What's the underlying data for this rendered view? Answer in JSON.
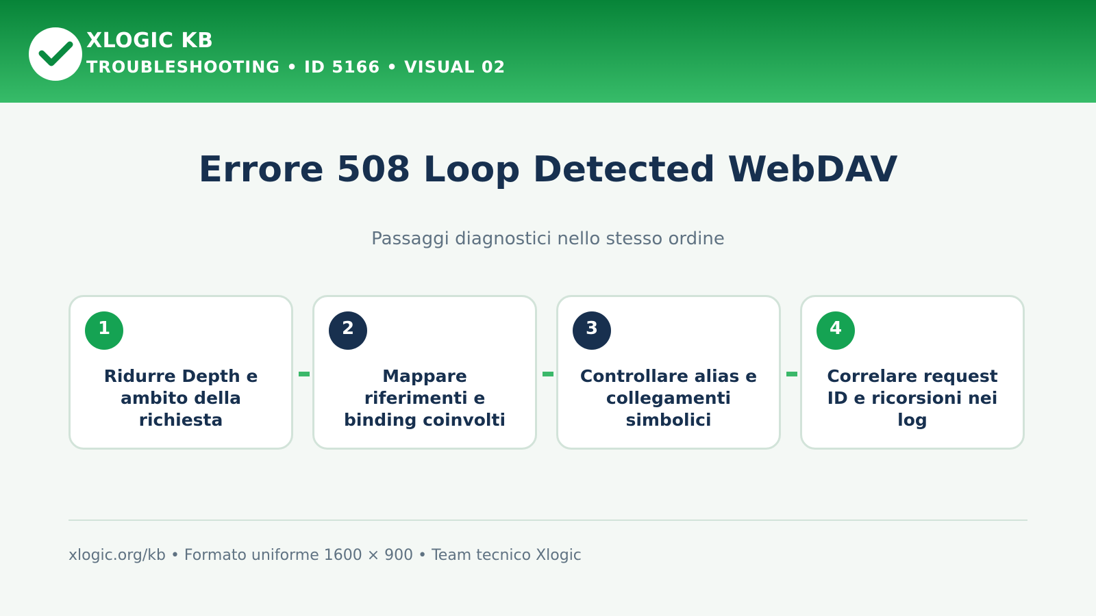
{
  "header": {
    "logo_icon": "check-icon",
    "brand": "XLOGIC KB",
    "subtitle": "TROUBLESHOOTING • ID 5166 • VISUAL 02",
    "colors": {
      "gradient_top": "#078438",
      "gradient_bottom": "#37bc69"
    }
  },
  "main": {
    "title": "Errore 508 Loop Detected WebDAV",
    "subtitle": "Passaggi diagnostici nello stesso ordine"
  },
  "steps": [
    {
      "number": "1",
      "text": "Ridurre Depth e ambito della richiesta",
      "badge_color": "#15a353"
    },
    {
      "number": "2",
      "text": "Mappare riferimenti e binding coinvolti",
      "badge_color": "#18304f"
    },
    {
      "number": "3",
      "text": "Controllare alias e collegamenti simbolici",
      "badge_color": "#18304f"
    },
    {
      "number": "4",
      "text": "Correlare request ID e ricorsioni nei log",
      "badge_color": "#15a353"
    }
  ],
  "footer": {
    "text": "xlogic.org/kb • Formato uniforme 1600 × 900 • Team tecnico Xlogic"
  }
}
